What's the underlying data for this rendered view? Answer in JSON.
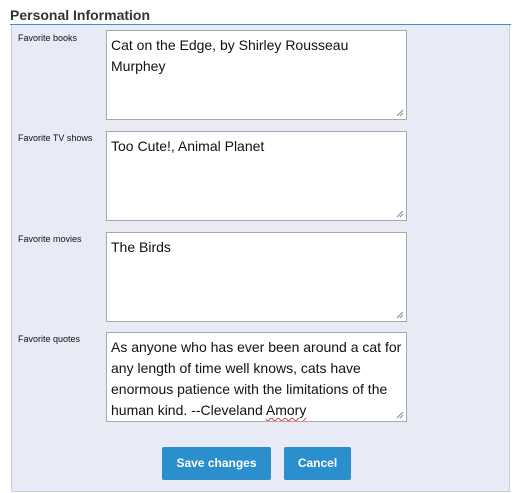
{
  "section": {
    "title": "Personal Information"
  },
  "fields": [
    {
      "label": "Favorite books",
      "value": "Cat on the Edge, by Shirley Rousseau Murphey"
    },
    {
      "label": "Favorite TV shows",
      "value": "Too Cute!, Animal Planet"
    },
    {
      "label": "Favorite movies",
      "value": "The Birds"
    },
    {
      "label": "Favorite quotes",
      "value_main": "As anyone who has ever been around a cat for any length of time well knows, cats have enormous patience with the limitations of the human kind. --Cleveland ",
      "value_flagged": "Amory"
    }
  ],
  "actions": {
    "save_label": "Save changes",
    "cancel_label": "Cancel"
  },
  "colors": {
    "accent": "#2b8fcd",
    "panel_bg": "#e8eaf6",
    "spellcheck": "#e0393e"
  }
}
